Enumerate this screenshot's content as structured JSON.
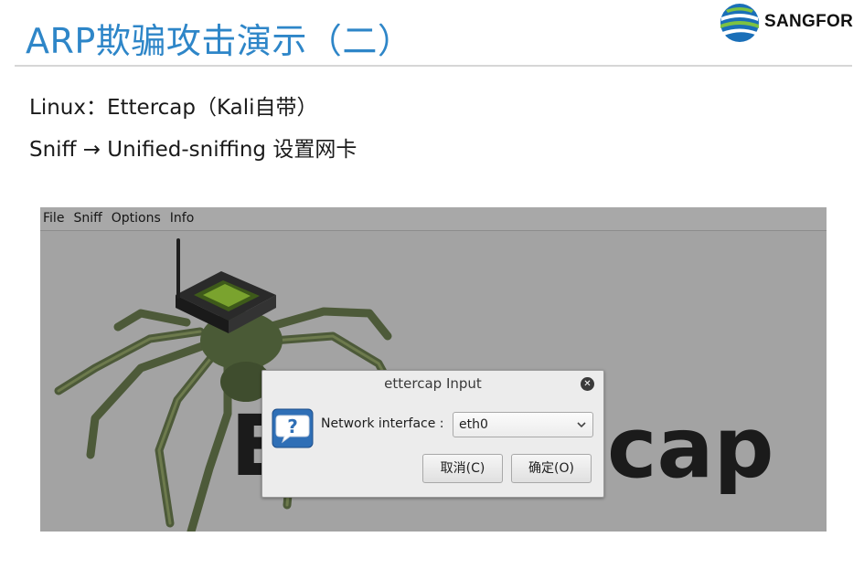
{
  "slide": {
    "title": "ARP欺骗攻击演示（二）",
    "logo_text": "SANGFOR",
    "line1": "Linux：Ettercap（Kali自带）",
    "line2": "Sniff → Unified-sniffing 设置网卡"
  },
  "app": {
    "menu": [
      "File",
      "Sniff",
      "Options",
      "Info"
    ],
    "logo_left": "E",
    "logo_right": "cap",
    "icon": "spider-router-illustration"
  },
  "dialog": {
    "title": "ettercap Input",
    "close_icon": "close-icon",
    "question_icon": "question-icon",
    "field_label": "Network interface :",
    "interface_value": "eth0",
    "cancel_label": "取消(C)",
    "ok_label": "确定(O)"
  },
  "colors": {
    "title": "#2e86c8",
    "app_bg": "#a3a3a3",
    "dialog_bg": "#ececec",
    "icon_blue": "#2f6fb6"
  }
}
